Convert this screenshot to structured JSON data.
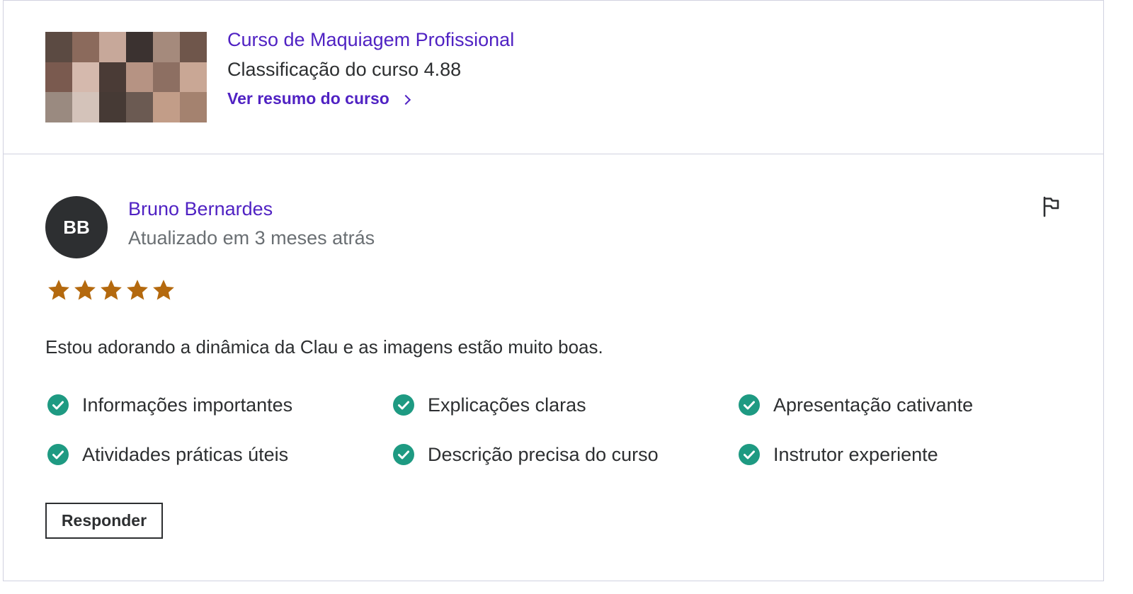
{
  "course": {
    "title": "Curso de Maquiagem Profissional",
    "rating_text": "Classificação do curso 4.88",
    "summary_link": "Ver resumo do curso",
    "thumbnail_icon": "course-collage-image"
  },
  "review": {
    "avatar_initials": "BB",
    "reviewer_name": "Bruno Bernardes",
    "updated": "Atualizado em 3 meses atrás",
    "stars": 5,
    "stars_max": 5,
    "comment": "Estou adorando a dinâmica da Clau e as imagens estão muito boas.",
    "tags": [
      "Informações importantes",
      "Explicações claras",
      "Apresentação cativante",
      "Atividades práticas úteis",
      "Descrição precisa do curso",
      "Instrutor experiente"
    ],
    "reply_label": "Responder",
    "flag_icon": "flag-icon"
  },
  "colors": {
    "link": "#5022c3",
    "star": "#b4690e",
    "check": "#1e9a82",
    "text": "#2d2f31",
    "muted": "#6a6f73",
    "avatar_bg": "#2d2f31",
    "border": "#d1d2e0"
  }
}
